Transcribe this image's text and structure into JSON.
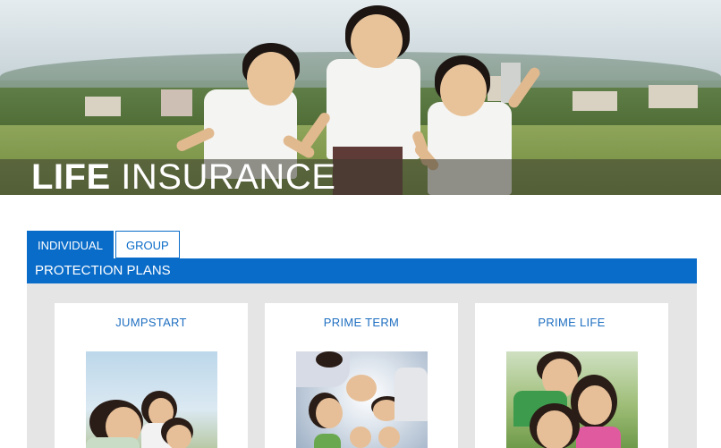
{
  "hero": {
    "title_bold": "LIFE",
    "title_light": "INSURANCE"
  },
  "tabs": [
    {
      "label": "INDIVIDUAL",
      "active": true
    },
    {
      "label": "GROUP",
      "active": false
    }
  ],
  "section": {
    "title": "PROTECTION PLANS"
  },
  "plans": [
    {
      "title": "JUMPSTART"
    },
    {
      "title": "PRIME TERM"
    },
    {
      "title": "PRIME LIFE"
    }
  ],
  "colors": {
    "accent": "#0a6cc9",
    "card_title": "#1f6fc1",
    "panel_bg": "#e5e5e5"
  }
}
